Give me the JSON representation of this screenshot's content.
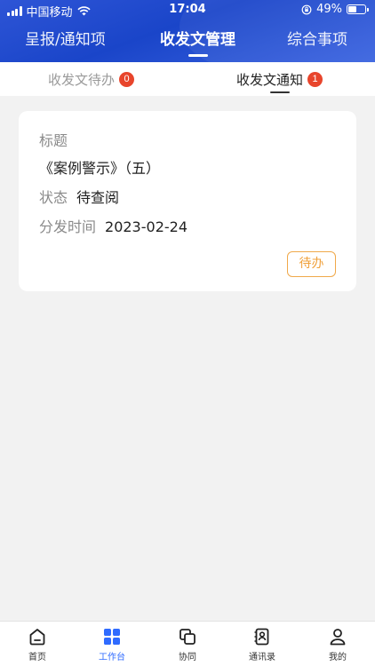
{
  "status_bar": {
    "carrier": "中国移动",
    "time": "17:04",
    "battery": "49%"
  },
  "top_tabs": [
    {
      "label": "呈报/通知项"
    },
    {
      "label": "收发文管理"
    },
    {
      "label": "综合事项"
    }
  ],
  "active_top_tab": 1,
  "sub_tabs": [
    {
      "label": "收发文待办",
      "badge": "0"
    },
    {
      "label": "收发文通知",
      "badge": "1"
    }
  ],
  "active_sub_tab": 1,
  "card": {
    "title_label": "标题",
    "title": "《案例警示》（五）",
    "status_label": "状态",
    "status": "待查阅",
    "date_label": "分发时间",
    "date": "2023-02-24",
    "action": "待办"
  },
  "bottom_nav": [
    {
      "label": "首页",
      "icon": "home-icon"
    },
    {
      "label": "工作台",
      "icon": "grid-icon"
    },
    {
      "label": "协同",
      "icon": "collaborate-icon"
    },
    {
      "label": "通讯录",
      "icon": "contacts-book-icon"
    },
    {
      "label": "我的",
      "icon": "user-icon"
    }
  ],
  "active_nav": 1,
  "colors": {
    "header": "#1f4bd0",
    "accent": "#2f6bff",
    "badge": "#e8452c",
    "pending": "#f0a03a"
  }
}
